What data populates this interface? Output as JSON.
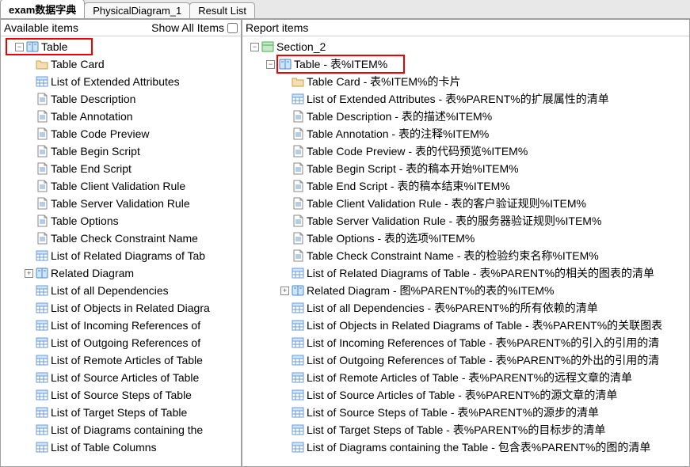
{
  "tabs": [
    {
      "label": "exam数据字典",
      "active": true
    },
    {
      "label": "PhysicalDiagram_1",
      "active": false
    },
    {
      "label": "Result List",
      "active": false
    }
  ],
  "left": {
    "title": "Available items",
    "showAll": "Show All Items",
    "root": "Table",
    "children": [
      {
        "icon": "folder",
        "label": "Table Card"
      },
      {
        "icon": "grid",
        "label": "List of Extended Attributes"
      },
      {
        "icon": "page",
        "label": "Table Description"
      },
      {
        "icon": "page",
        "label": "Table Annotation"
      },
      {
        "icon": "page",
        "label": "Table Code Preview"
      },
      {
        "icon": "page",
        "label": "Table Begin Script"
      },
      {
        "icon": "page",
        "label": "Table End Script"
      },
      {
        "icon": "page",
        "label": "Table Client Validation Rule"
      },
      {
        "icon": "page",
        "label": "Table Server Validation Rule"
      },
      {
        "icon": "page",
        "label": "Table Options"
      },
      {
        "icon": "page",
        "label": "Table Check Constraint Name"
      },
      {
        "icon": "grid",
        "label": "List of Related Diagrams of Tab"
      },
      {
        "icon": "book",
        "label": "Related Diagram",
        "expandable": true
      },
      {
        "icon": "grid",
        "label": "List of all Dependencies"
      },
      {
        "icon": "grid",
        "label": "List of Objects in Related Diagra"
      },
      {
        "icon": "grid",
        "label": "List of Incoming References of"
      },
      {
        "icon": "grid",
        "label": "List of Outgoing References of"
      },
      {
        "icon": "grid",
        "label": "List of Remote Articles of Table"
      },
      {
        "icon": "grid",
        "label": "List of Source Articles of Table"
      },
      {
        "icon": "grid",
        "label": "List of Source Steps of Table"
      },
      {
        "icon": "grid",
        "label": "List of Target Steps of Table"
      },
      {
        "icon": "grid",
        "label": "List of Diagrams containing the"
      },
      {
        "icon": "grid",
        "label": "List of Table Columns"
      }
    ]
  },
  "right": {
    "title": "Report items",
    "root": "Section_2",
    "table": "Table - 表%ITEM%",
    "children": [
      {
        "icon": "folder",
        "label": "Table Card - 表%ITEM%的卡片"
      },
      {
        "icon": "grid",
        "label": "List of Extended Attributes - 表%PARENT%的扩展属性的清单"
      },
      {
        "icon": "page",
        "label": "Table Description - 表的描述%ITEM%"
      },
      {
        "icon": "page",
        "label": "Table Annotation - 表的注释%ITEM%"
      },
      {
        "icon": "page",
        "label": "Table Code Preview - 表的代码预览%ITEM%"
      },
      {
        "icon": "page",
        "label": "Table Begin Script - 表的稿本开始%ITEM%"
      },
      {
        "icon": "page",
        "label": "Table End Script - 表的稿本结束%ITEM%"
      },
      {
        "icon": "page",
        "label": "Table Client Validation Rule - 表的客户验证规则%ITEM%"
      },
      {
        "icon": "page",
        "label": "Table Server Validation Rule - 表的服务器验证规则%ITEM%"
      },
      {
        "icon": "page",
        "label": "Table Options - 表的选项%ITEM%"
      },
      {
        "icon": "page",
        "label": "Table Check Constraint Name - 表的检验约束名称%ITEM%"
      },
      {
        "icon": "grid",
        "label": "List of Related Diagrams of Table - 表%PARENT%的相关的图表的清单"
      },
      {
        "icon": "book",
        "label": "Related Diagram - 图%PARENT%的表的%ITEM%",
        "expandable": true
      },
      {
        "icon": "grid",
        "label": "List of all Dependencies - 表%PARENT%的所有依赖的清单"
      },
      {
        "icon": "grid",
        "label": "List of Objects in Related Diagrams of Table - 表%PARENT%的关联图表"
      },
      {
        "icon": "grid",
        "label": "List of Incoming References of Table - 表%PARENT%的引入的引用的清"
      },
      {
        "icon": "grid",
        "label": "List of Outgoing References of Table - 表%PARENT%的外出的引用的清"
      },
      {
        "icon": "grid",
        "label": "List of Remote Articles of Table - 表%PARENT%的远程文章的清单"
      },
      {
        "icon": "grid",
        "label": "List of Source Articles of Table - 表%PARENT%的源文章的清单"
      },
      {
        "icon": "grid",
        "label": "List of Source Steps of Table - 表%PARENT%的源步的清单"
      },
      {
        "icon": "grid",
        "label": "List of Target Steps of Table - 表%PARENT%的目标步的清单"
      },
      {
        "icon": "grid",
        "label": "List of Diagrams containing the Table - 包含表%PARENT%的图的清单"
      }
    ]
  }
}
